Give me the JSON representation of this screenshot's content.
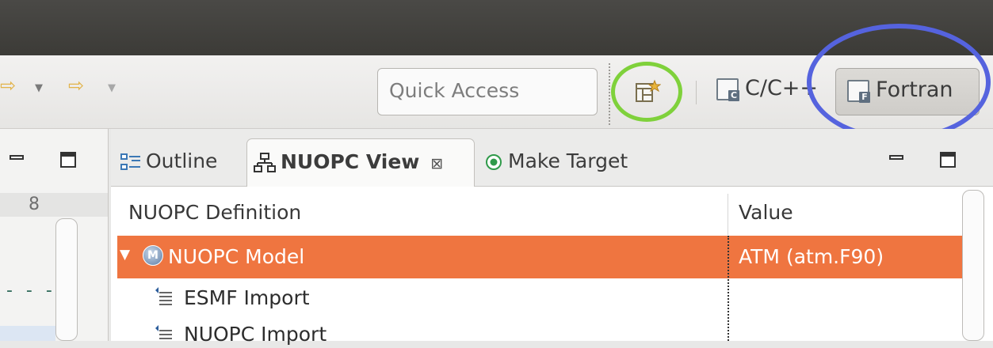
{
  "toolbar": {
    "quick_access_placeholder": "Quick Access",
    "perspectives": [
      {
        "label": "C/C++",
        "icon": "c-perspective-icon",
        "badge": "C"
      },
      {
        "label": "Fortran",
        "icon": "fortran-perspective-icon",
        "badge": "F",
        "selected": true
      }
    ],
    "annotation_colors": {
      "green_circle": "#7fd13b",
      "blue_circle": "#5563de"
    }
  },
  "left_panel": {
    "ruler_number": "8"
  },
  "view": {
    "tabs": [
      {
        "label": "Outline",
        "icon": "outline-icon"
      },
      {
        "label": "NUOPC View",
        "icon": "nuopc-tree-icon",
        "active": true,
        "close": "⊠"
      },
      {
        "label": "Make Target",
        "icon": "make-target-icon"
      }
    ],
    "columns": {
      "definition": "NUOPC Definition",
      "value": "Value"
    },
    "rows": [
      {
        "label": "NUOPC Model",
        "value": "ATM (atm.F90)",
        "selected": true,
        "expanded": true,
        "badge": "M"
      },
      {
        "label": "ESMF Import",
        "value": ""
      },
      {
        "label": "NUOPC Import",
        "value": ""
      }
    ],
    "colors": {
      "selection": "#ef7540"
    }
  }
}
